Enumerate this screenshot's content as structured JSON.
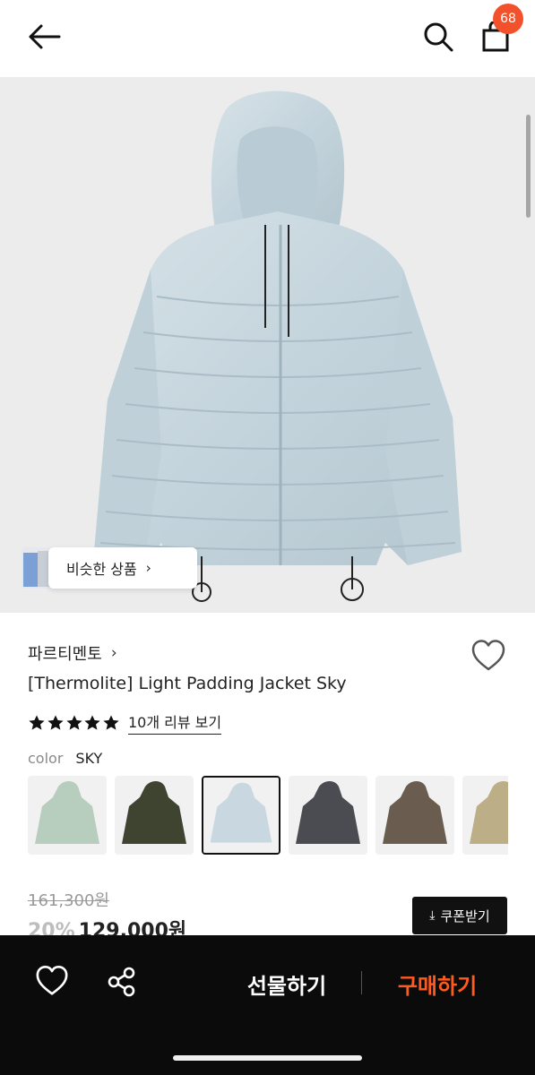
{
  "header": {
    "back_icon": "arrow-left-icon",
    "search_icon": "search-icon",
    "cart_icon": "shopping-bag-icon",
    "cart_count": "68",
    "badge_color": "#f2512b"
  },
  "hero": {
    "similar_label": "비슷한 상품",
    "similar_chevron": "›"
  },
  "product": {
    "brand": "파르티멘토",
    "brand_chevron": "›",
    "name": "[Thermolite] Light Padding Jacket Sky",
    "rating_stars": 5,
    "review_link": "10개 리뷰 보기",
    "color_label": "color",
    "color_value": "SKY",
    "swatches": [
      {
        "name": "mint",
        "color": "#b7cdbd"
      },
      {
        "name": "olive",
        "color": "#3f4431"
      },
      {
        "name": "sky",
        "color": "#c9d8e0",
        "selected": true
      },
      {
        "name": "charcoal",
        "color": "#4a4c52"
      },
      {
        "name": "brown",
        "color": "#6a5d50"
      },
      {
        "name": "beige",
        "color": "#bcae86"
      }
    ]
  },
  "pricing": {
    "original_price": "161,300원",
    "discount": "20%",
    "sale_price": "129,000원",
    "coupon_label": "쿠폰받기",
    "coupon_icon": "download-icon"
  },
  "bottom_bar": {
    "like_icon": "heart-icon",
    "share_icon": "share-icon",
    "gift_label": "선물하기",
    "buy_label": "구매하기",
    "buy_color": "#ff5a1f"
  }
}
